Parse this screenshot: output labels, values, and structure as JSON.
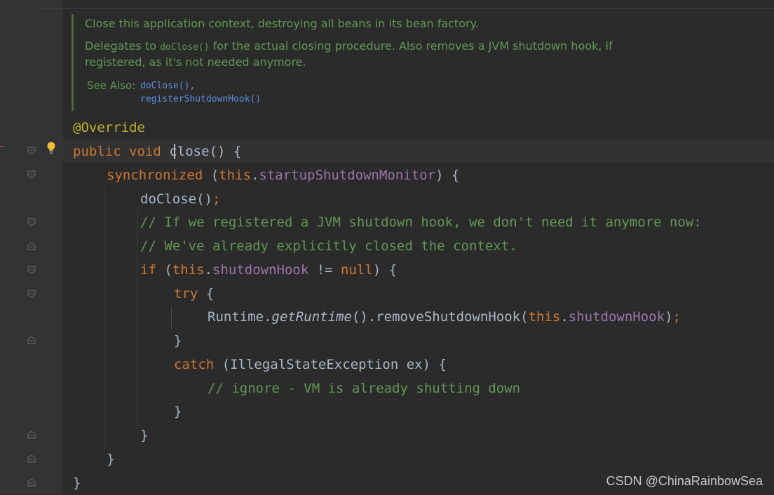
{
  "doc": {
    "summary": "Close this application context, destroying all beans in its bean factory.",
    "delegates_prefix": "Delegates to ",
    "delegates_code": "doClose()",
    "delegates_rest": " for the actual closing procedure. Also removes a JVM shutdown hook, if",
    "delegates_line2": "registered, as it's not needed anymore.",
    "see_also_label": "See Also:",
    "see_also_links": [
      "doClose(),",
      "registerShutdownHook()"
    ]
  },
  "code": {
    "annotation": "@Override",
    "l1": {
      "kw1": "public",
      "kw2": "void",
      "name": "close",
      "rest": "() {"
    },
    "l2": {
      "kw": "synchronized",
      "open": " (",
      "this": "this",
      "dot": ".",
      "field": "startupShutdownMonitor",
      "close": ") {"
    },
    "l3": {
      "call": "doClose()",
      "semi": ";"
    },
    "l4": "// If we registered a JVM shutdown hook, we don't need it anymore now:",
    "l5": "// We've already explicitly closed the context.",
    "l6": {
      "kw": "if",
      "open": " (",
      "this": "this",
      "dot": ".",
      "field": "shutdownHook",
      "op": " != ",
      "null": "null",
      "close": ") {"
    },
    "l7": {
      "kw": "try",
      "rest": " {"
    },
    "l8": {
      "cls": "Runtime.",
      "method": "getRuntime",
      "mid": "().removeShutdownHook(",
      "this": "this",
      "dot": ".",
      "field": "shutdownHook",
      "close": ")",
      "semi": ";"
    },
    "l9": "}",
    "l10": {
      "kw": "catch",
      "rest": " (IllegalStateException ex) {"
    },
    "l11": "// ignore - VM is already shutting down",
    "l12": "}",
    "l13": "}",
    "l14": "}",
    "l15": "}"
  },
  "watermark": "CSDN @ChinaRainbowSea",
  "icons": {
    "bulb": "lightbulb-icon",
    "fold": "fold-marker-icon"
  },
  "colors": {
    "keyword": "#cc7832",
    "annotation": "#bbb529",
    "field": "#9876aa",
    "comment": "#629755",
    "text": "#a9b7c6",
    "link": "#5c8fdf",
    "background": "#2b2b2b"
  }
}
